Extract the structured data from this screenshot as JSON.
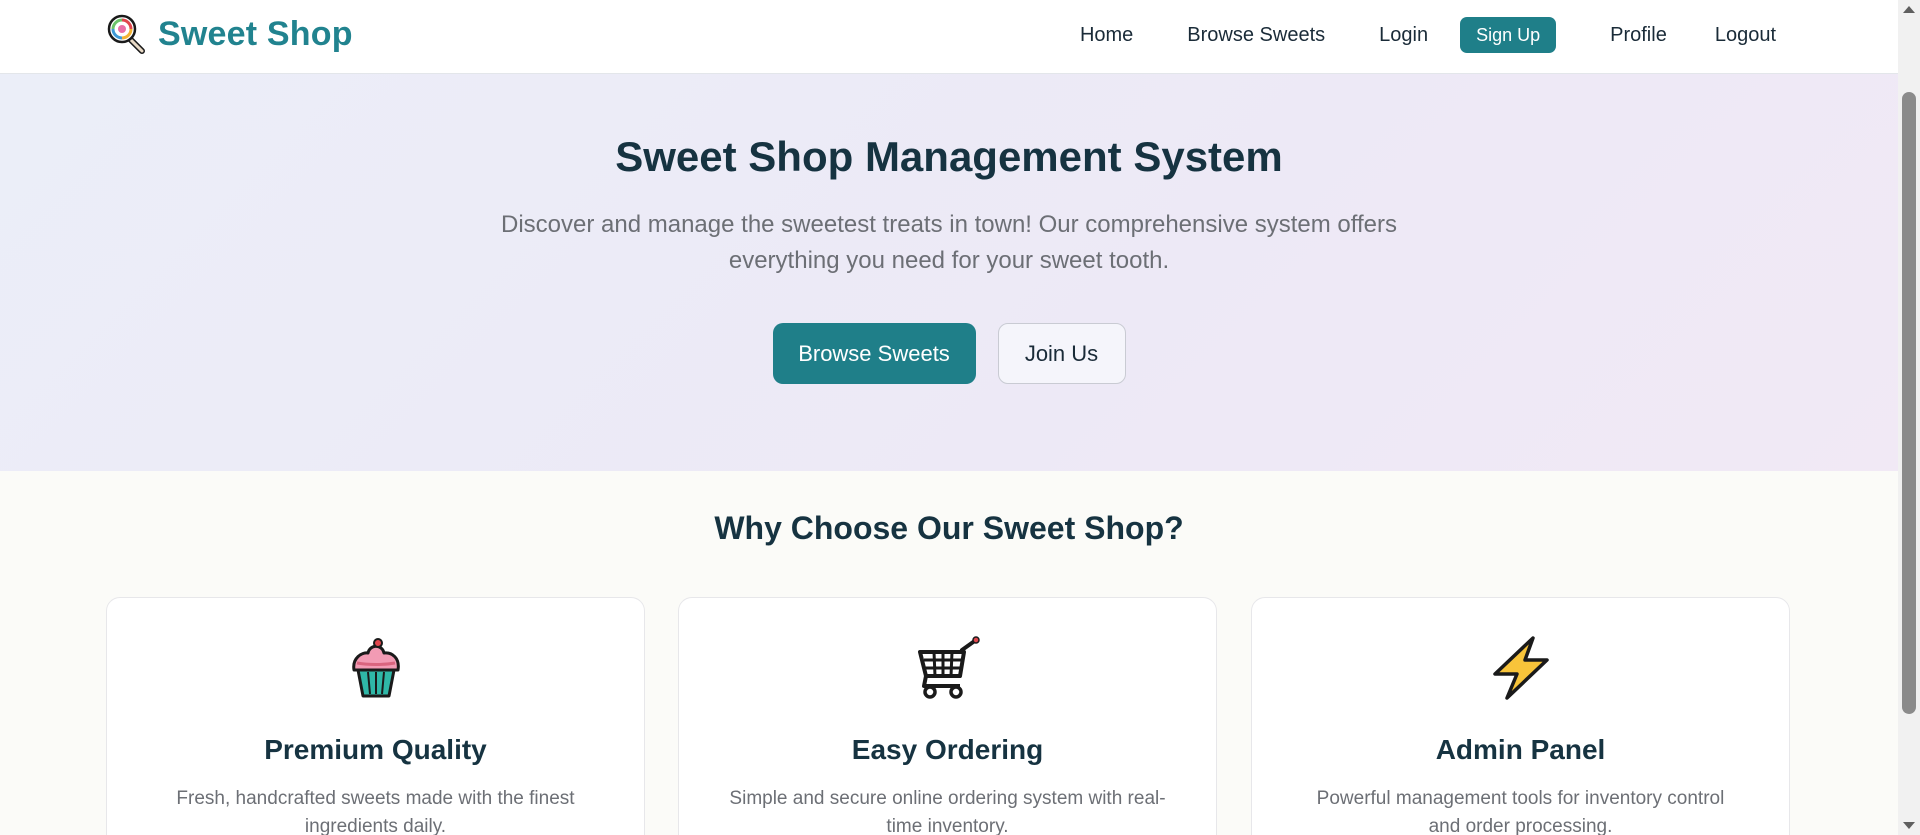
{
  "navbar": {
    "brand": {
      "text": "Sweet Shop",
      "icon": "lollipop-icon"
    },
    "links": {
      "home": "Home",
      "browse": "Browse Sweets",
      "login": "Login",
      "signup": "Sign Up",
      "profile": "Profile",
      "logout": "Logout"
    }
  },
  "hero": {
    "title": "Sweet Shop Management System",
    "subtitle": "Discover and manage the sweetest treats in town! Our comprehensive system offers everything you need for your sweet tooth.",
    "primary_button": "Browse Sweets",
    "secondary_button": "Join Us"
  },
  "features": {
    "title": "Why Choose Our Sweet Shop?",
    "items": [
      {
        "icon": "cupcake-icon",
        "title": "Premium Quality",
        "description": "Fresh, handcrafted sweets made with the finest ingredients daily."
      },
      {
        "icon": "shopping-cart-icon",
        "title": "Easy Ordering",
        "description": "Simple and secure online ordering system with real-time inventory."
      },
      {
        "icon": "lightning-icon",
        "title": "Admin Panel",
        "description": "Powerful management tools for inventory control and order processing."
      }
    ]
  },
  "colors": {
    "accent": "#1f7f89",
    "brand_text": "#21838f",
    "heading": "#163341",
    "muted_text": "#6c6f75",
    "hero_bg": "#ede9f6"
  }
}
